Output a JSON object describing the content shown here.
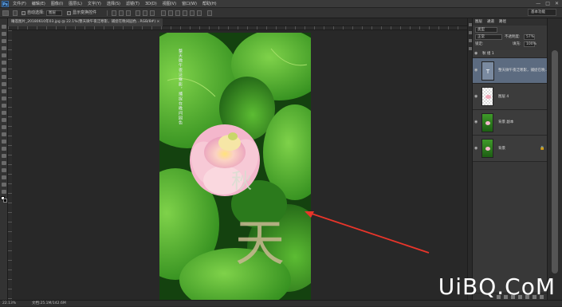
{
  "app": {
    "logo_text": "Ps"
  },
  "menubar": {
    "items": [
      "文件(F)",
      "编辑(E)",
      "图像(I)",
      "图层(L)",
      "文字(Y)",
      "选择(S)",
      "滤镜(T)",
      "3D(D)",
      "视图(V)",
      "窗口(W)",
      "帮助(H)"
    ],
    "window_controls": [
      "—",
      "□",
      "✕"
    ]
  },
  "options": {
    "auto_select_label": "自动选择:",
    "auto_select_value": "图层",
    "show_transform_label": "显示变换控件"
  },
  "workspace": {
    "label": "基本功能"
  },
  "document": {
    "tab_title": "睡莲图片_20180610年03.jpg @ 22.1%(整天微午夜泛寒影，捕捉在晚间园色...RGB/8#) ×"
  },
  "status": {
    "zoom": "22.13%",
    "doc_info": "文档:25.1M/142.6M"
  },
  "layers_panel": {
    "tabs": [
      "图层",
      "通道",
      "路径"
    ],
    "kind_value": "类型",
    "mode_value": "正常",
    "opacity_label": "不透明度:",
    "opacity_value": "57%",
    "lock_label": "锁定:",
    "fill_label": "填充:",
    "fill_value": "100%",
    "group_name": "秋  组 1",
    "layers": [
      {
        "name": "整天微午夜泛寒影，捕捉在晚..",
        "kind": "text"
      },
      {
        "name": "图层 4",
        "kind": "flower"
      },
      {
        "name": "背景 副本",
        "kind": "photo"
      },
      {
        "name": "背景",
        "kind": "photo",
        "locked": true
      }
    ]
  },
  "photo": {
    "poem_text": "整天微午夜泛寒影，捕捉在晚间园色",
    "title_chars": [
      "秋",
      "天"
    ]
  },
  "watermark": "UiBQ.CoM",
  "colors": {
    "annotation_arrow": "#e8352a"
  }
}
